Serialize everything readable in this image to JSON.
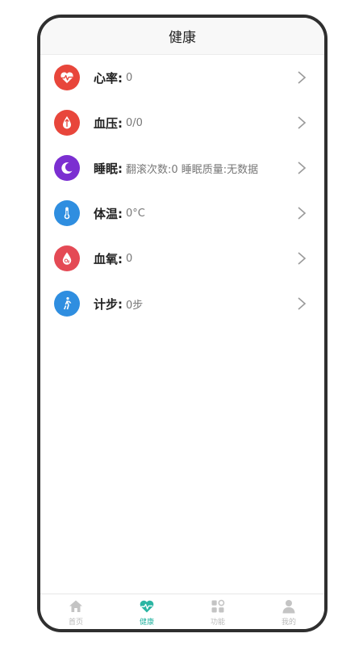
{
  "header": {
    "title": "健康"
  },
  "items": [
    {
      "key": "heart_rate",
      "label": "心率:",
      "value": "0",
      "icon": "heart-pulse-icon",
      "color": "#e8463b"
    },
    {
      "key": "blood_pressure",
      "label": "血压:",
      "value": "0/0",
      "icon": "blood-drop-arrow-icon",
      "color": "#e8463b"
    },
    {
      "key": "sleep",
      "label": "睡眠:",
      "value": "翻滚次数:0 睡眠质量:无数据",
      "icon": "moon-zz-icon",
      "color": "#7b2fd1"
    },
    {
      "key": "temperature",
      "label": "体温:",
      "value": "0°C",
      "icon": "thermometer-icon",
      "color": "#2f8ee0"
    },
    {
      "key": "blood_oxygen",
      "label": "血氧:",
      "value": "0",
      "icon": "oxygen-drop-icon",
      "color": "#e44a55"
    },
    {
      "key": "steps",
      "label": "计步:",
      "value": "0步",
      "icon": "walking-icon",
      "color": "#2f8ee0"
    }
  ],
  "tabs": [
    {
      "label": "首页",
      "icon": "home-icon",
      "active": false
    },
    {
      "label": "健康",
      "icon": "heart-pulse-icon",
      "active": true
    },
    {
      "label": "功能",
      "icon": "grid-icon",
      "active": false
    },
    {
      "label": "我的",
      "icon": "person-icon",
      "active": false
    }
  ],
  "colors": {
    "accent": "#2bb5a3",
    "inactive": "#c4c4c4"
  }
}
